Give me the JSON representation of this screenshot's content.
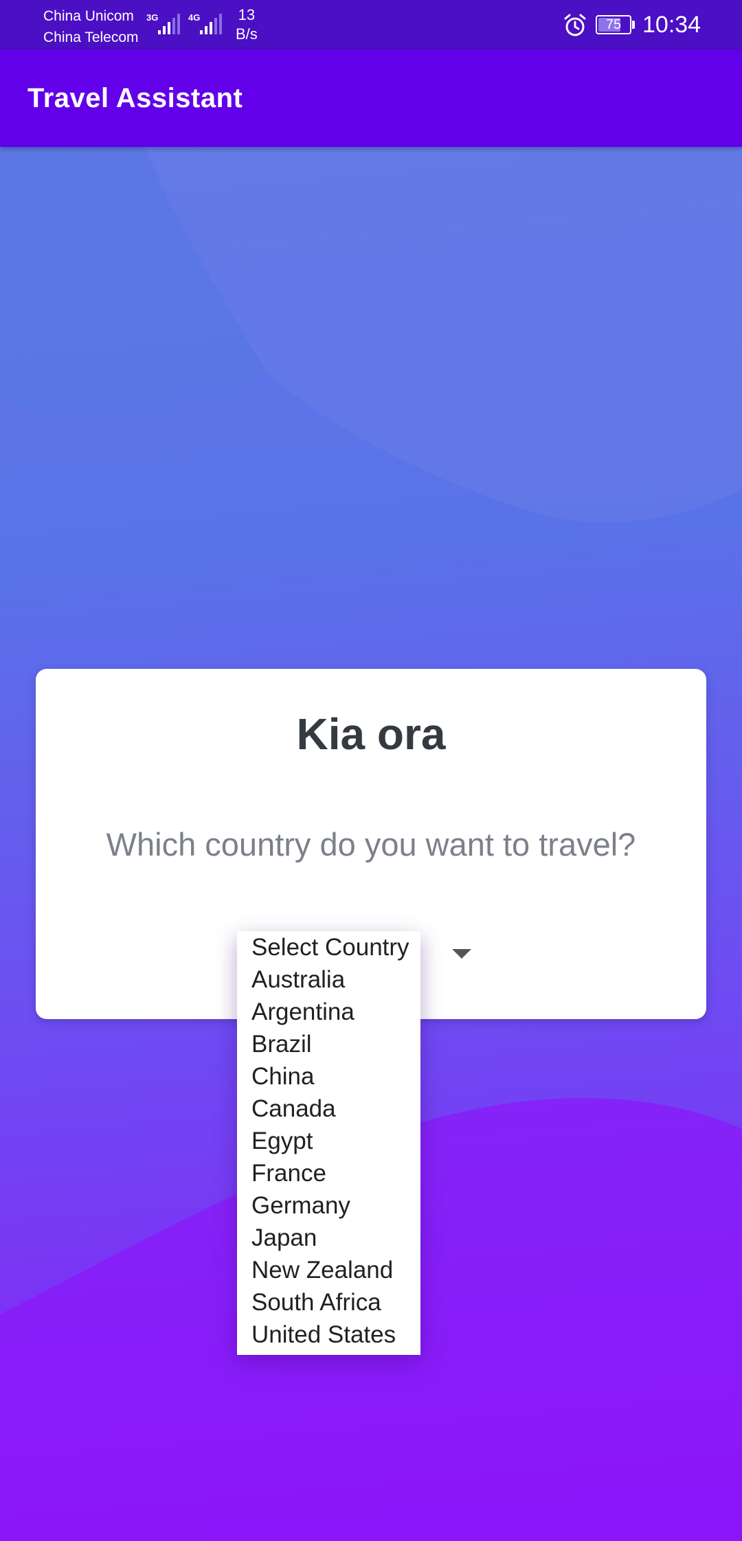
{
  "status_bar": {
    "carrier_1": "China Unicom",
    "carrier_2": "China Telecom",
    "net_1": "3G",
    "net_2": "4G",
    "speed_value": "13",
    "speed_unit": "B/s",
    "battery": "75",
    "battery_level": 0.75,
    "time": "10:34",
    "alarm_icon": "alarm-icon"
  },
  "app_bar": {
    "title": "Travel Assistant"
  },
  "card": {
    "greeting": "Kia ora",
    "question": "Which country do you want to travel?"
  },
  "country_select": {
    "options": [
      "Select Country",
      "Australia",
      "Argentina",
      "Brazil",
      "China",
      "Canada",
      "Egypt",
      "France",
      "Germany",
      "Japan",
      "New Zealand",
      "South Africa",
      "United States"
    ]
  },
  "colors": {
    "app_bar": "#6200ea",
    "status_bar": "#4b0fc4",
    "heading_text": "#343a40",
    "question_text": "#7b8089"
  }
}
